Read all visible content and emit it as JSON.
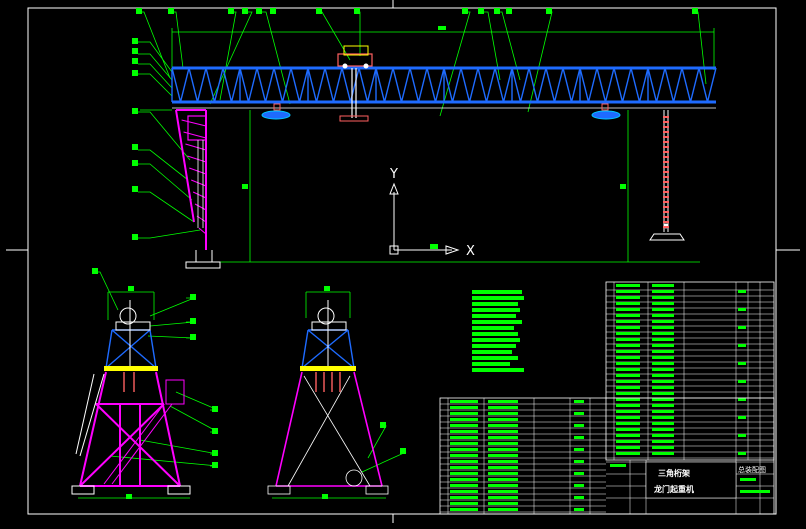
{
  "drawing": {
    "axis_labels": {
      "y": "Y",
      "x": "X"
    },
    "title_block": {
      "title_line1": "三角桁架",
      "title_line2": "龙门起重机",
      "corner_label": "总装配图"
    },
    "colors": {
      "background": "#000000",
      "frame": "#ffffff",
      "truss": "#1e6bff",
      "leg": "#ff00ff",
      "leader": "#00ff00",
      "text_block": "#00ff00",
      "trolley": "#ff6060",
      "rail": "#ffff00",
      "cyan": "#00c8ff"
    }
  }
}
